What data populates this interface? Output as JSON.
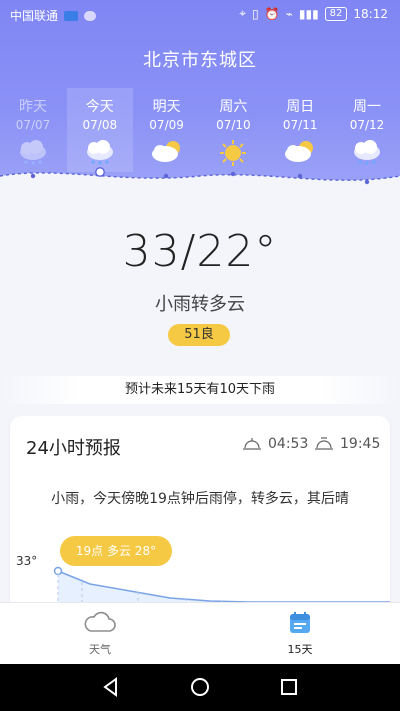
{
  "status_bar": {
    "carrier": "中国联通",
    "battery": "82",
    "time": "18:12"
  },
  "header": {
    "city": "北京市东城区"
  },
  "days": [
    {
      "name": "昨天",
      "date": "07/07",
      "icon": "cloud-rain-icon",
      "state": "past"
    },
    {
      "name": "今天",
      "date": "07/08",
      "icon": "cloud-rain-icon",
      "state": "selected"
    },
    {
      "name": "明天",
      "date": "07/09",
      "icon": "partly-cloudy-icon",
      "state": "normal"
    },
    {
      "name": "周六",
      "date": "07/10",
      "icon": "sun-icon",
      "state": "normal"
    },
    {
      "name": "周日",
      "date": "07/11",
      "icon": "partly-cloudy-icon",
      "state": "normal"
    },
    {
      "name": "周一",
      "date": "07/12",
      "icon": "cloud-rain-icon",
      "state": "normal"
    }
  ],
  "today": {
    "temperature": "33/22°",
    "condition": "小雨转多云",
    "aqi": "51良"
  },
  "forecast_note": "预计未来15天有10天下雨",
  "hourly": {
    "title": "24小时预报",
    "sunrise": "04:53",
    "sunset": "19:45",
    "summary": "小雨，今天傍晚19点钟后雨停，转多云，其后晴",
    "bubble": "19点 多云 28°",
    "y_tick": "33°"
  },
  "tabs": [
    {
      "label": "天气",
      "icon": "cloud-icon"
    },
    {
      "label": "15天",
      "icon": "calendar-icon"
    }
  ],
  "colors": {
    "header_gradient_top": "#7f86f4",
    "header_gradient_bottom": "#9ca3f7",
    "accent_yellow": "#f6c944",
    "tab_active_blue": "#54a9f1"
  }
}
